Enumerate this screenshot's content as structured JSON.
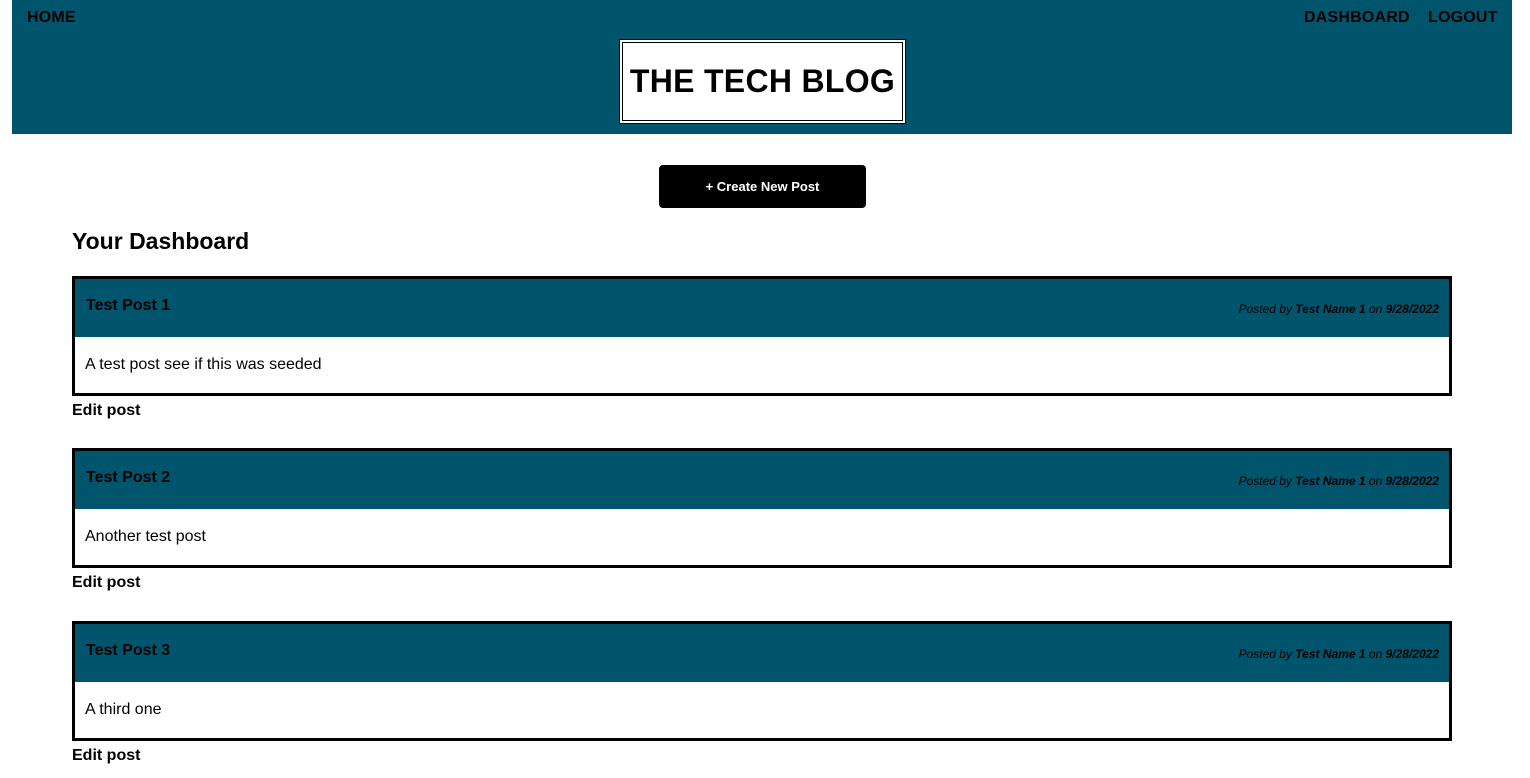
{
  "nav": {
    "home": "HOME",
    "dashboard": "DASHBOARD",
    "logout": "LOGOUT"
  },
  "brand": {
    "title": "THE TECH BLOG"
  },
  "create_button": {
    "label": "+ Create New Post"
  },
  "page_title": "Your Dashboard",
  "meta_labels": {
    "posted_by": "Posted by",
    "on": "on"
  },
  "edit_label": "Edit post",
  "posts": [
    {
      "title": "Test Post 1",
      "author": "Test Name 1",
      "date": "9/28/2022",
      "body": "A test post see if this was seeded"
    },
    {
      "title": "Test Post 2",
      "author": "Test Name 1",
      "date": "9/28/2022",
      "body": "Another test post"
    },
    {
      "title": "Test Post 3",
      "author": "Test Name 1",
      "date": "9/28/2022",
      "body": "A third one"
    }
  ],
  "colors": {
    "header": "#00546b",
    "button": "#000000"
  }
}
